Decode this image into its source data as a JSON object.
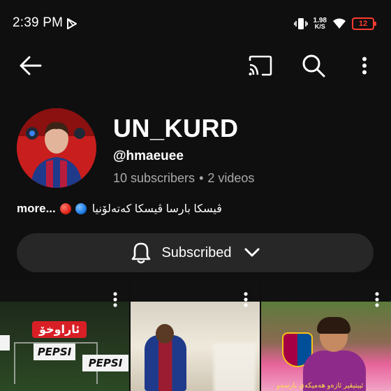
{
  "status_bar": {
    "time": "2:39 PM",
    "net_speed_value": "1.98",
    "net_speed_unit": "K/S",
    "battery_level": "12",
    "icons": [
      "play-store-icon",
      "vibrate-icon",
      "wifi-icon",
      "battery-icon"
    ]
  },
  "app_bar": {
    "icons": [
      "back-arrow-icon",
      "cast-icon",
      "search-icon",
      "more-vert-icon"
    ]
  },
  "channel": {
    "name": "UN_KURD",
    "handle": "@hmaeuee",
    "subscribers": "10 subscribers",
    "separator": "•",
    "videos": "2 videos"
  },
  "description": {
    "more": "more...",
    "text": "ڤیسکا بارسا  ڤیسکا کەتەلۆنیا"
  },
  "subscribe_button": {
    "label": "Subscribed"
  },
  "shorts": [
    {
      "caption": "ئاراوخۆ",
      "boards": [
        "PEPSI",
        "PEPSI"
      ]
    },
    {
      "caption": ""
    },
    {
      "caption": "ئیبتیقیر ئازەو هەمیکەی بارسەو"
    }
  ],
  "colors": {
    "background": "#0f0f0f",
    "subscribe_bg": "#272727",
    "battery_low": "#ff3b30",
    "secondary_text": "#aaaaaa"
  }
}
